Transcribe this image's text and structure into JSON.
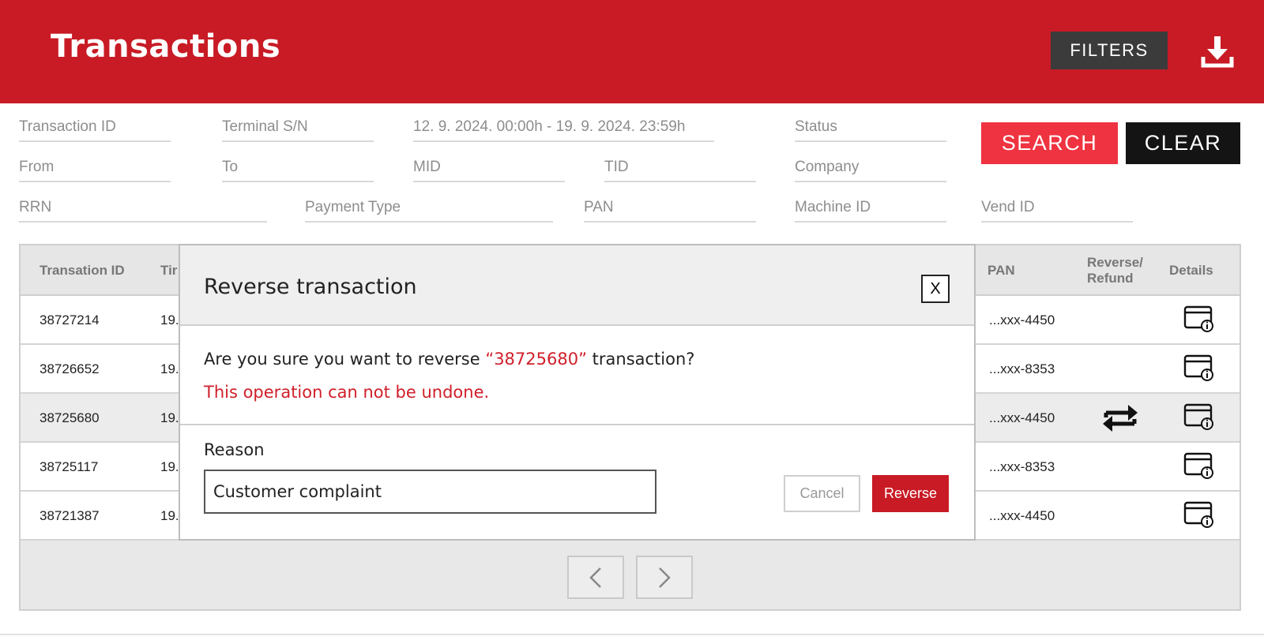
{
  "header": {
    "title": "Transactions",
    "filters_label": "FILTERS",
    "download_icon": "download-icon",
    "color": "#c81b25"
  },
  "filters": {
    "transaction_id": "Transaction ID",
    "terminal_sn": "Terminal S/N",
    "date_range": "12. 9. 2024. 00:00h - 19. 9. 2024. 23:59h",
    "status": "Status",
    "from": "From",
    "to": "To",
    "mid": "MID",
    "tid": "TID",
    "company": "Company",
    "rrn": "RRN",
    "payment_type": "Payment Type",
    "pan": "PAN",
    "machine_id": "Machine ID",
    "vend_id": "Vend ID",
    "search_label": "SEARCH",
    "clear_label": "CLEAR"
  },
  "table": {
    "headers": {
      "transaction_id": "Transation ID",
      "time": "Tir",
      "pan": "PAN",
      "reverse_refund": [
        "Reverse/",
        "Refund"
      ],
      "details": "Details"
    },
    "rows": [
      {
        "id": "38727214",
        "time": "19.(",
        "pan": "...xxx-4450",
        "reversible": false
      },
      {
        "id": "38726652",
        "time": "19.(",
        "pan": "...xxx-8353",
        "reversible": false
      },
      {
        "id": "38725680",
        "time": "19.(",
        "pan": "...xxx-4450",
        "reversible": true
      },
      {
        "id": "38725117",
        "time": "19.(",
        "pan": "...xxx-8353",
        "reversible": false
      },
      {
        "id": "38721387",
        "time": "19.(",
        "pan": "...xxx-4450",
        "reversible": false
      }
    ]
  },
  "pagination": {
    "prev_icon": "chevron-left-icon",
    "next_icon": "chevron-right-icon"
  },
  "modal": {
    "title": "Reverse transaction",
    "close_label": "X",
    "message_prefix": "Are you sure you want to reverse ",
    "message_id": "“38725680”",
    "message_suffix": " transaction?",
    "warning": "This operation can not be undone.",
    "reason_label": "Reason",
    "reason_value": "Customer complaint",
    "cancel_label": "Cancel",
    "reverse_label": "Reverse"
  }
}
